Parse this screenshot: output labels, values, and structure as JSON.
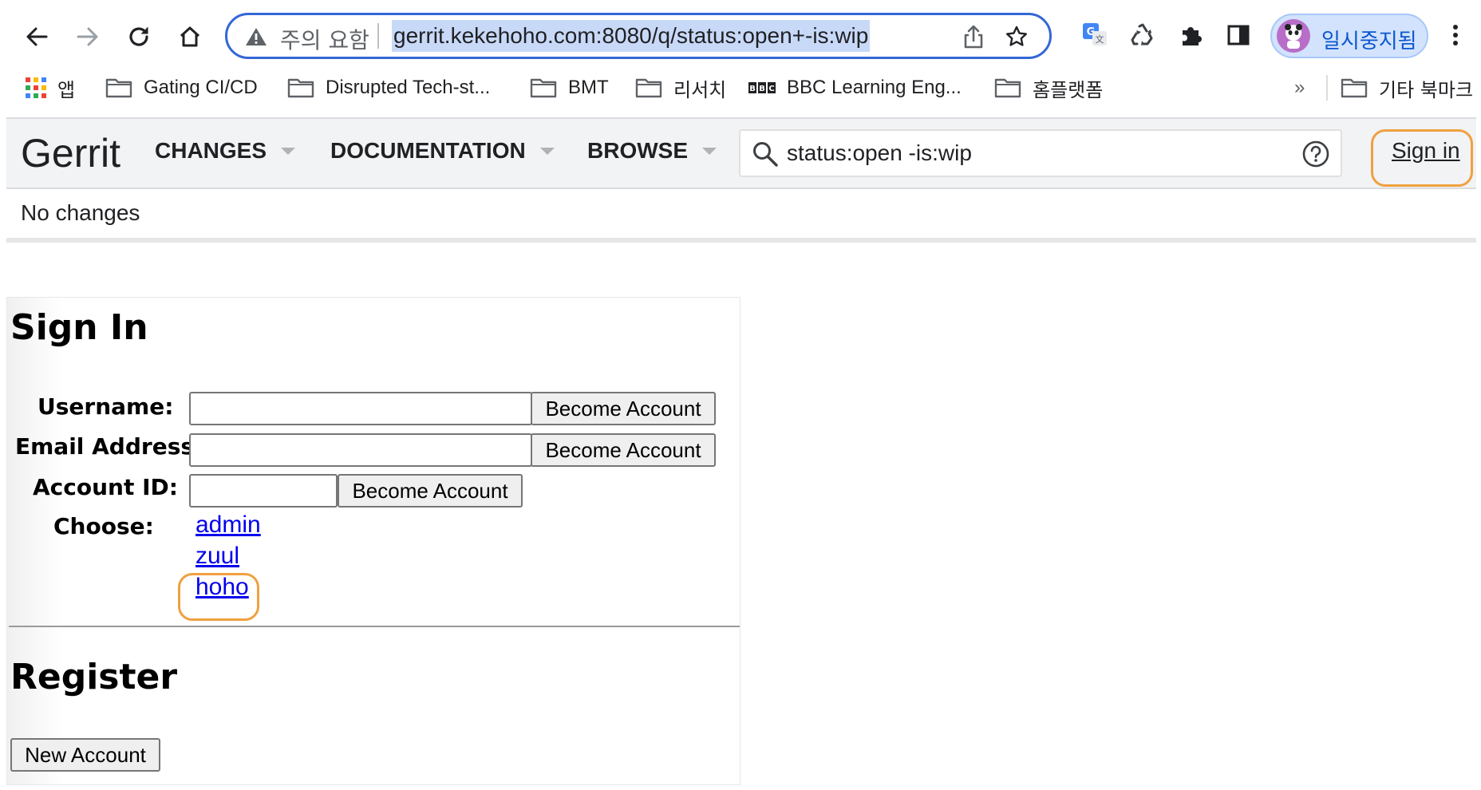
{
  "browser": {
    "security_warning": "주의 요함",
    "url": "gerrit.kekehoho.com:8080/q/status:open+-is:wip",
    "profile_label": "일시중지됨"
  },
  "bookmarks": [
    {
      "label": "앱",
      "icon": "apps-grid-icon"
    },
    {
      "label": "Gating CI/CD",
      "icon": "folder-icon"
    },
    {
      "label": "Disrupted Tech-st...",
      "icon": "folder-icon"
    },
    {
      "label": "BMT",
      "icon": "folder-icon"
    },
    {
      "label": "리서치",
      "icon": "folder-icon"
    },
    {
      "label": "BBC Learning Eng...",
      "icon": "bbc-icon"
    },
    {
      "label": "홈플랫폼",
      "icon": "folder-icon"
    }
  ],
  "bookmarks_overflow": "»",
  "other_bookmarks": "기타 북마크",
  "gerrit": {
    "logo": "Gerrit",
    "nav": {
      "changes": "CHANGES",
      "documentation": "DOCUMENTATION",
      "browse": "BROWSE"
    },
    "search_value": "status:open -is:wip",
    "sign_in": "Sign in",
    "no_changes": "No changes"
  },
  "signin": {
    "title": "Sign In",
    "username_label": "Username:",
    "email_label": "Email Address:",
    "account_id_label": "Account ID:",
    "choose_label": "Choose:",
    "become_button": "Become Account",
    "accounts": [
      "admin",
      "zuul",
      "hoho"
    ]
  },
  "register": {
    "title": "Register",
    "new_account_button": "New Account"
  },
  "colors": {
    "highlight": "#f0a040",
    "link": "#0000ee",
    "omnibox_border": "#3367d6"
  }
}
